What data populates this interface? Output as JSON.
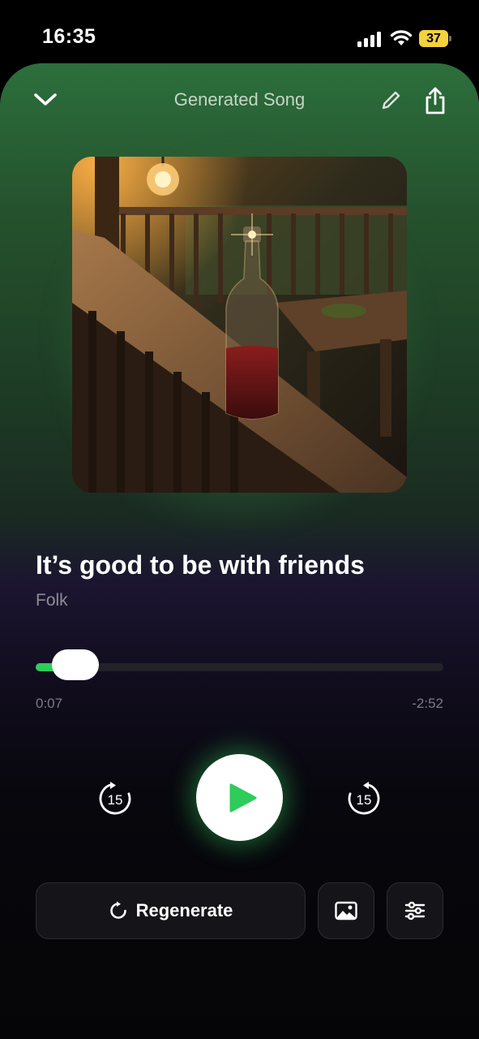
{
  "status_bar": {
    "time": "16:35",
    "battery_level": "37",
    "icons": [
      "signal-icon",
      "wifi-icon",
      "battery-icon"
    ]
  },
  "header": {
    "title": "Generated Song",
    "icons": [
      "chevron-down-icon",
      "pencil-icon",
      "share-icon"
    ]
  },
  "artwork": {
    "icon": "album-artwork-image"
  },
  "song": {
    "title": "It’s good to be with friends",
    "genre": "Folk"
  },
  "playback": {
    "elapsed": "0:07",
    "remaining": "-2:52",
    "progress_fraction": 0.04,
    "skip_back_seconds": "15",
    "skip_forward_seconds": "15",
    "state": "paused"
  },
  "actions": {
    "regenerate_label": "Regenerate",
    "icons": [
      "refresh-icon",
      "image-icon",
      "sliders-icon"
    ]
  },
  "colors": {
    "accent": "#2ecc5a",
    "sheet_top": "#2c6f3c",
    "background": "#050507"
  }
}
